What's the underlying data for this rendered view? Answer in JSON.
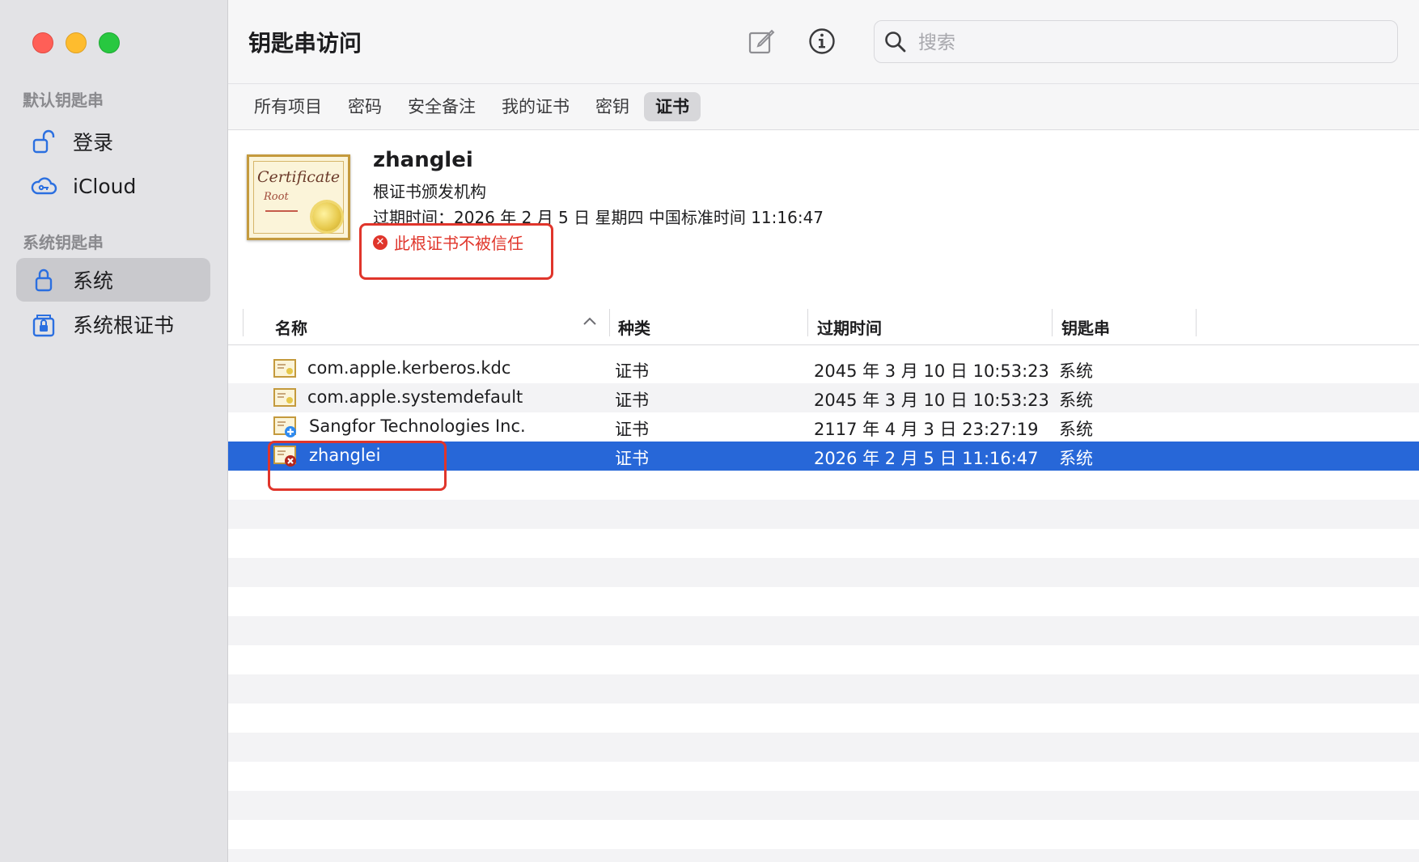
{
  "app": {
    "title": "钥匙串访问"
  },
  "sidebar": {
    "sections": [
      {
        "label": "默认钥匙串",
        "items": [
          {
            "label": "登录",
            "icon": "lock-open-icon"
          },
          {
            "label": "iCloud",
            "icon": "cloud-icon"
          }
        ]
      },
      {
        "label": "系统钥匙串",
        "items": [
          {
            "label": "系统",
            "icon": "lock-icon",
            "selected": true
          },
          {
            "label": "系统根证书",
            "icon": "lock-box-icon"
          }
        ]
      }
    ]
  },
  "toolbar": {
    "search_placeholder": "搜索"
  },
  "tabs": [
    {
      "label": "所有项目"
    },
    {
      "label": "密码"
    },
    {
      "label": "安全备注"
    },
    {
      "label": "我的证书"
    },
    {
      "label": "密钥"
    },
    {
      "label": "证书",
      "active": true
    }
  ],
  "detail": {
    "name": "zhanglei",
    "issuer": "根证书颁发机构",
    "expiry": "过期时间：2026 年 2 月 5 日 星期四 中国标准时间 11:16:47",
    "warning": "此根证书不被信任",
    "cert_image_text1": "Certificate",
    "cert_image_text2": "Root"
  },
  "table": {
    "columns": [
      "名称",
      "种类",
      "过期时间",
      "钥匙串"
    ],
    "rows": [
      {
        "name": "com.apple.kerberos.kdc",
        "kind": "证书",
        "expires": "2045 年 3 月 10 日 10:53:23",
        "keychain": "系统",
        "icon": "certificate-icon"
      },
      {
        "name": "com.apple.systemdefault",
        "kind": "证书",
        "expires": "2045 年 3 月 10 日 10:53:23",
        "keychain": "系统",
        "icon": "certificate-icon"
      },
      {
        "name": "Sangfor Technologies Inc.",
        "kind": "证书",
        "expires": "2117 年 4 月 3 日 23:27:19",
        "keychain": "系统",
        "icon": "certificate-plus-icon"
      },
      {
        "name": "zhanglei",
        "kind": "证书",
        "expires": "2026 年 2 月 5 日 11:16:47",
        "keychain": "系统",
        "icon": "certificate-untrusted-icon",
        "selected": true
      }
    ]
  },
  "colors": {
    "selection": "#2767d8",
    "warning": "#e0352b",
    "sidebar_bg": "#e3e3e6"
  }
}
